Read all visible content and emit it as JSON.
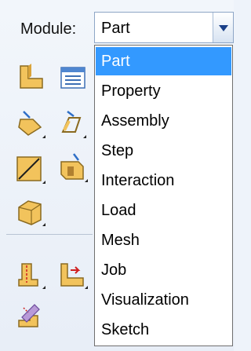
{
  "module_label": "Module:",
  "combo_value": "Part",
  "dropdown_items": [
    "Part",
    "Property",
    "Assembly",
    "Step",
    "Interaction",
    "Load",
    "Mesh",
    "Job",
    "Visualization",
    "Sketch"
  ],
  "selected_item": "Part",
  "colors": {
    "selection": "#3399ff",
    "icon_body": "#f0c060"
  },
  "toolbar_icons": [
    "create-part-icon",
    "part-manager-icon",
    "extrude-solid-icon",
    "extrude-shell-icon",
    "cut-line-icon",
    "cut-extrude-icon",
    "solid-block-icon",
    "section-icon",
    "partition-icon",
    "edit-feature-icon"
  ]
}
